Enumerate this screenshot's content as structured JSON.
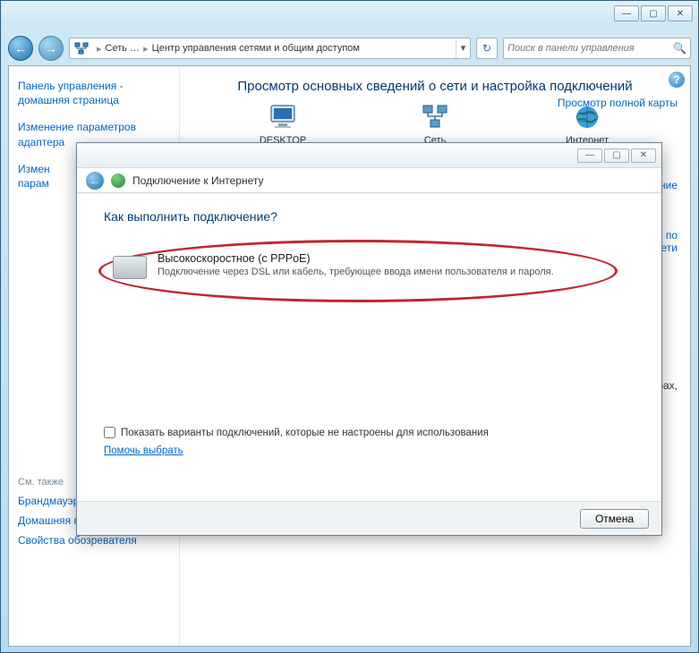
{
  "breadcrumb": {
    "root": "Сеть …",
    "current": "Центр управления сетями и общим доступом"
  },
  "search": {
    "placeholder": "Поиск в панели управления"
  },
  "sidebar": {
    "home": "Панель управления - домашняя страница",
    "adapter": "Изменение параметров адаптера",
    "sharing_trunc": "Измен",
    "sharing_line2": "парам",
    "see_also": "См. также",
    "firewall": "Брандмауэр Windows",
    "homegroup": "Домашняя группа",
    "internet_options": "Свойства обозревателя"
  },
  "content": {
    "heading": "Просмотр основных сведений о сети и настройка подключений",
    "map_link": "Просмотр полной карты",
    "items": {
      "desktop": "DESKTOP",
      "network": "Сеть",
      "internet": "Интернет"
    },
    "stub_connect": "лючение",
    "stub_trouble1": "ние по",
    "stub_trouble2": "сети",
    "stub_printers": "терах,"
  },
  "dialog": {
    "title": "Подключение к Интернету",
    "question": "Как выполнить подключение?",
    "option": {
      "title": "Высокоскоростное (с PPPoE)",
      "desc": "Подключение через DSL или кабель, требующее ввода имени пользователя и пароля."
    },
    "show_unconfigured": "Показать варианты подключений, которые не настроены для использования",
    "help_choose": "Помочь выбрать",
    "cancel": "Отмена"
  }
}
